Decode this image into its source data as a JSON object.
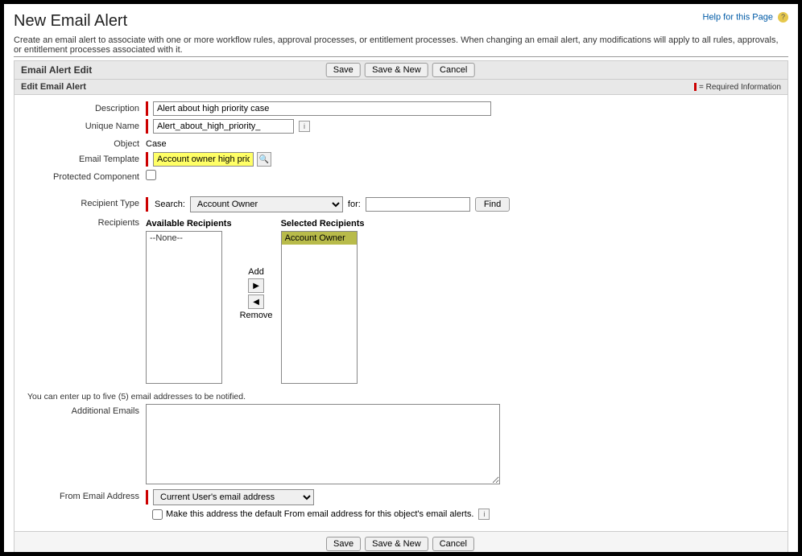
{
  "header": {
    "title": "New Email Alert",
    "help_text": "Help for this Page"
  },
  "intro": "Create an email alert to associate with one or more workflow rules, approval processes, or entitlement processes. When changing an email alert, any modifications will apply to all rules, approvals, or entitlement processes associated with it.",
  "section": {
    "edit_title": "Email Alert Edit",
    "sub_title": "Edit Email Alert",
    "required_text": "= Required Information"
  },
  "buttons": {
    "save": "Save",
    "save_new": "Save & New",
    "cancel": "Cancel",
    "find": "Find",
    "add": "Add",
    "remove": "Remove"
  },
  "labels": {
    "description": "Description",
    "unique_name": "Unique Name",
    "object": "Object",
    "email_template": "Email Template",
    "protected_component": "Protected Component",
    "recipient_type": "Recipient Type",
    "recipients": "Recipients",
    "available": "Available Recipients",
    "selected": "Selected Recipients",
    "additional_emails": "Additional Emails",
    "from_email": "From Email Address",
    "search": "Search:",
    "for": "for:"
  },
  "values": {
    "description": "Alert about high priority case",
    "unique_name": "Alert_about_high_priority_",
    "object": "Case",
    "email_template": "Account owner high priorit",
    "recipient_type_selected": "Account Owner",
    "for_search": "",
    "available_items": [
      "--None--"
    ],
    "selected_items": [
      "Account Owner"
    ],
    "additional_emails": "",
    "from_email_selected": "Current User's email address",
    "default_checkbox_label": "Make this address the default From email address for this object's email alerts."
  },
  "hints": {
    "five_emails": "You can enter up to five (5) email addresses to be notified."
  }
}
